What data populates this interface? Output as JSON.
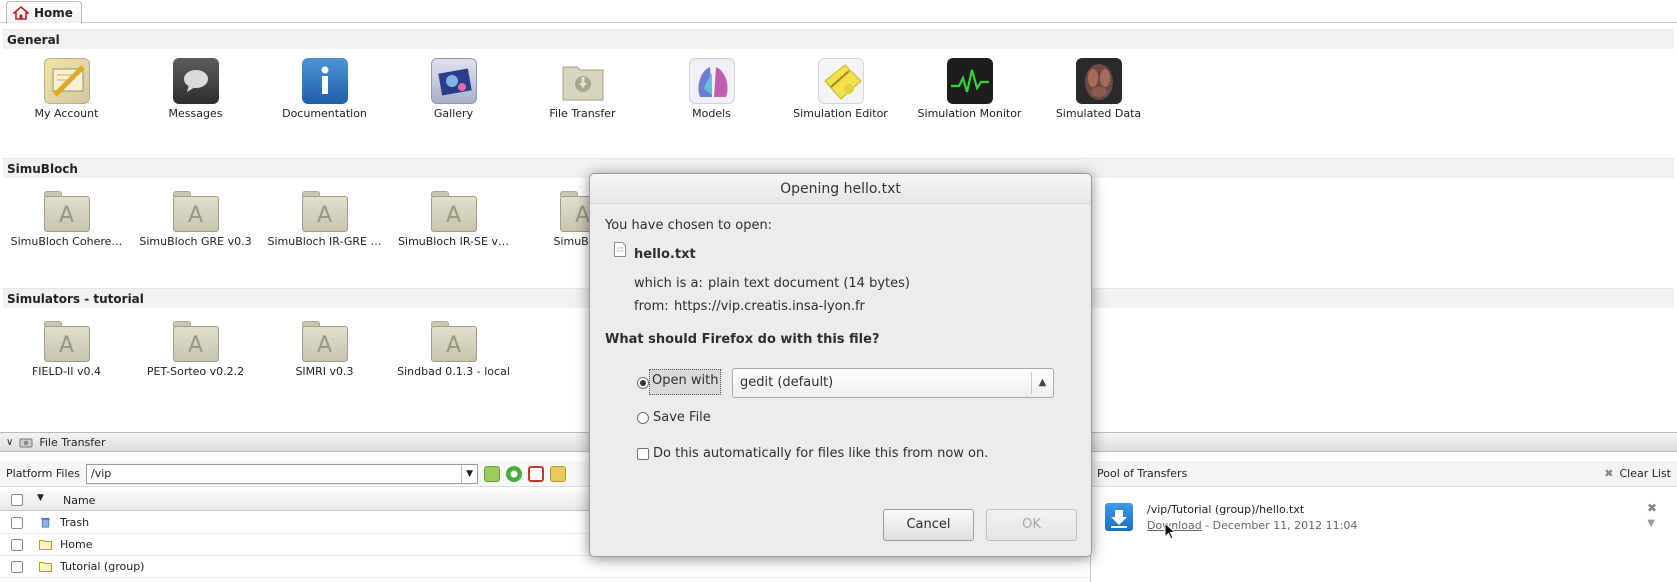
{
  "tabs": {
    "home": "Home"
  },
  "sections": {
    "general": {
      "title": "General",
      "apps": [
        "My Account",
        "Messages",
        "Documentation",
        "Gallery",
        "File Transfer",
        "Models",
        "Simulation Editor",
        "Simulation Monitor",
        "Simulated Data"
      ]
    },
    "simubloch": {
      "title": "SimuBloch",
      "apps": [
        "SimuBloch Cohere…",
        "SimuBloch GRE v0.3",
        "SimuBloch IR-GRE …",
        "SimuBloch IR-SE v…",
        "SimuBloch"
      ]
    },
    "simulators": {
      "title": "Simulators - tutorial",
      "apps": [
        "FIELD-II v0.4",
        "PET-Sorteo v0.2.2",
        "SIMRI v0.3",
        "Sindbad 0.1.3 - local"
      ]
    }
  },
  "file_transfer": {
    "title": "File Transfer",
    "platform_label": "Platform Files",
    "path_value": "/vip",
    "name_header": "Name",
    "rows": [
      "Trash",
      "Home",
      "Tutorial (group)"
    ]
  },
  "pool": {
    "title": "Pool of Transfers",
    "clear": "Clear List",
    "item_path": "/vip/Tutorial (group)/hello.txt",
    "item_action": "Download",
    "item_date": " - December 11, 2012 11:04"
  },
  "dialog": {
    "title": "Opening hello.txt",
    "chosen": "You have chosen to open:",
    "filename": "hello.txt",
    "which_is_label": "which is a:",
    "which_is_value": "plain text document (14 bytes)",
    "from_label": "from:",
    "from_value": "https://vip.creatis.insa-lyon.fr",
    "question": "What should Firefox do with this file?",
    "open_with": "Open with",
    "open_with_app": "gedit (default)",
    "save_file": "Save File",
    "auto": "Do this automatically for files like this from now on.",
    "cancel": "Cancel",
    "ok": "OK"
  }
}
